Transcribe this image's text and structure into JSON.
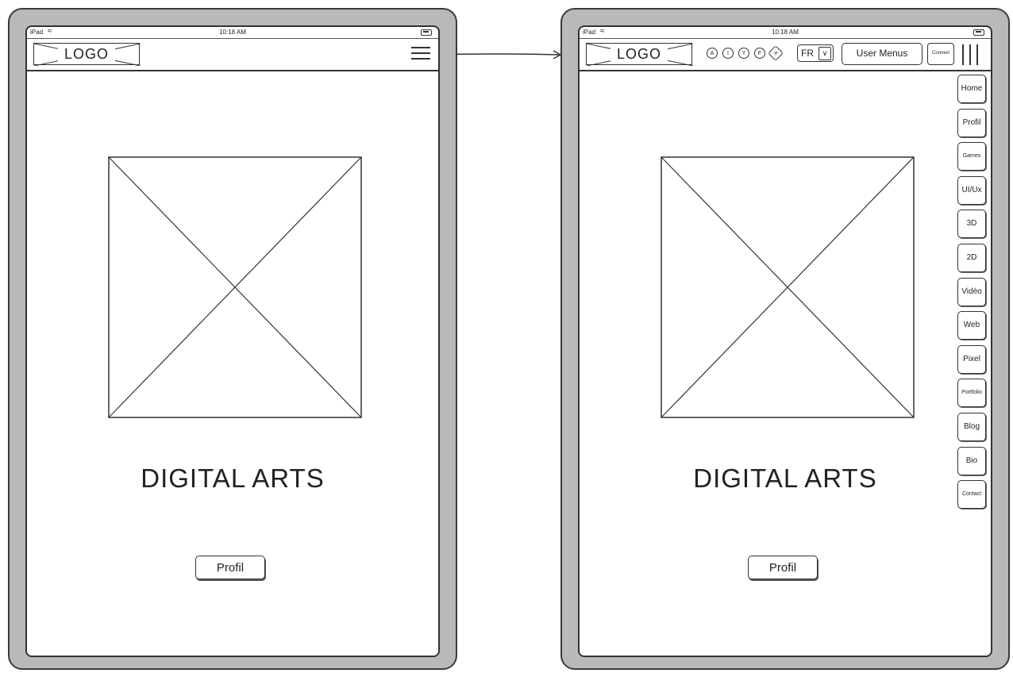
{
  "left_device": {
    "status": {
      "carrier": "iPad",
      "time": "10:18 AM"
    },
    "logo": "LOGO",
    "hero_title": "DIGITAL ARTS",
    "profil_button": "Profil"
  },
  "right_device": {
    "status": {
      "carrier": "iPad",
      "time": "10:18 AM"
    },
    "logo": "LOGO",
    "social_icons": [
      "A",
      "I",
      "Y",
      "F",
      "X"
    ],
    "language": "FR",
    "user_menus": "User Menus",
    "connexion": "Connexi",
    "side_menu": [
      "Home",
      "Profil",
      "Games",
      "UI/Ux",
      "3D",
      "2D",
      "Vidéo",
      "Web",
      "Pixel",
      "Portfolio",
      "Blog",
      "Bio",
      "Contact"
    ],
    "hero_title": "DIGITAL ARTS",
    "profil_button": "Profil"
  }
}
